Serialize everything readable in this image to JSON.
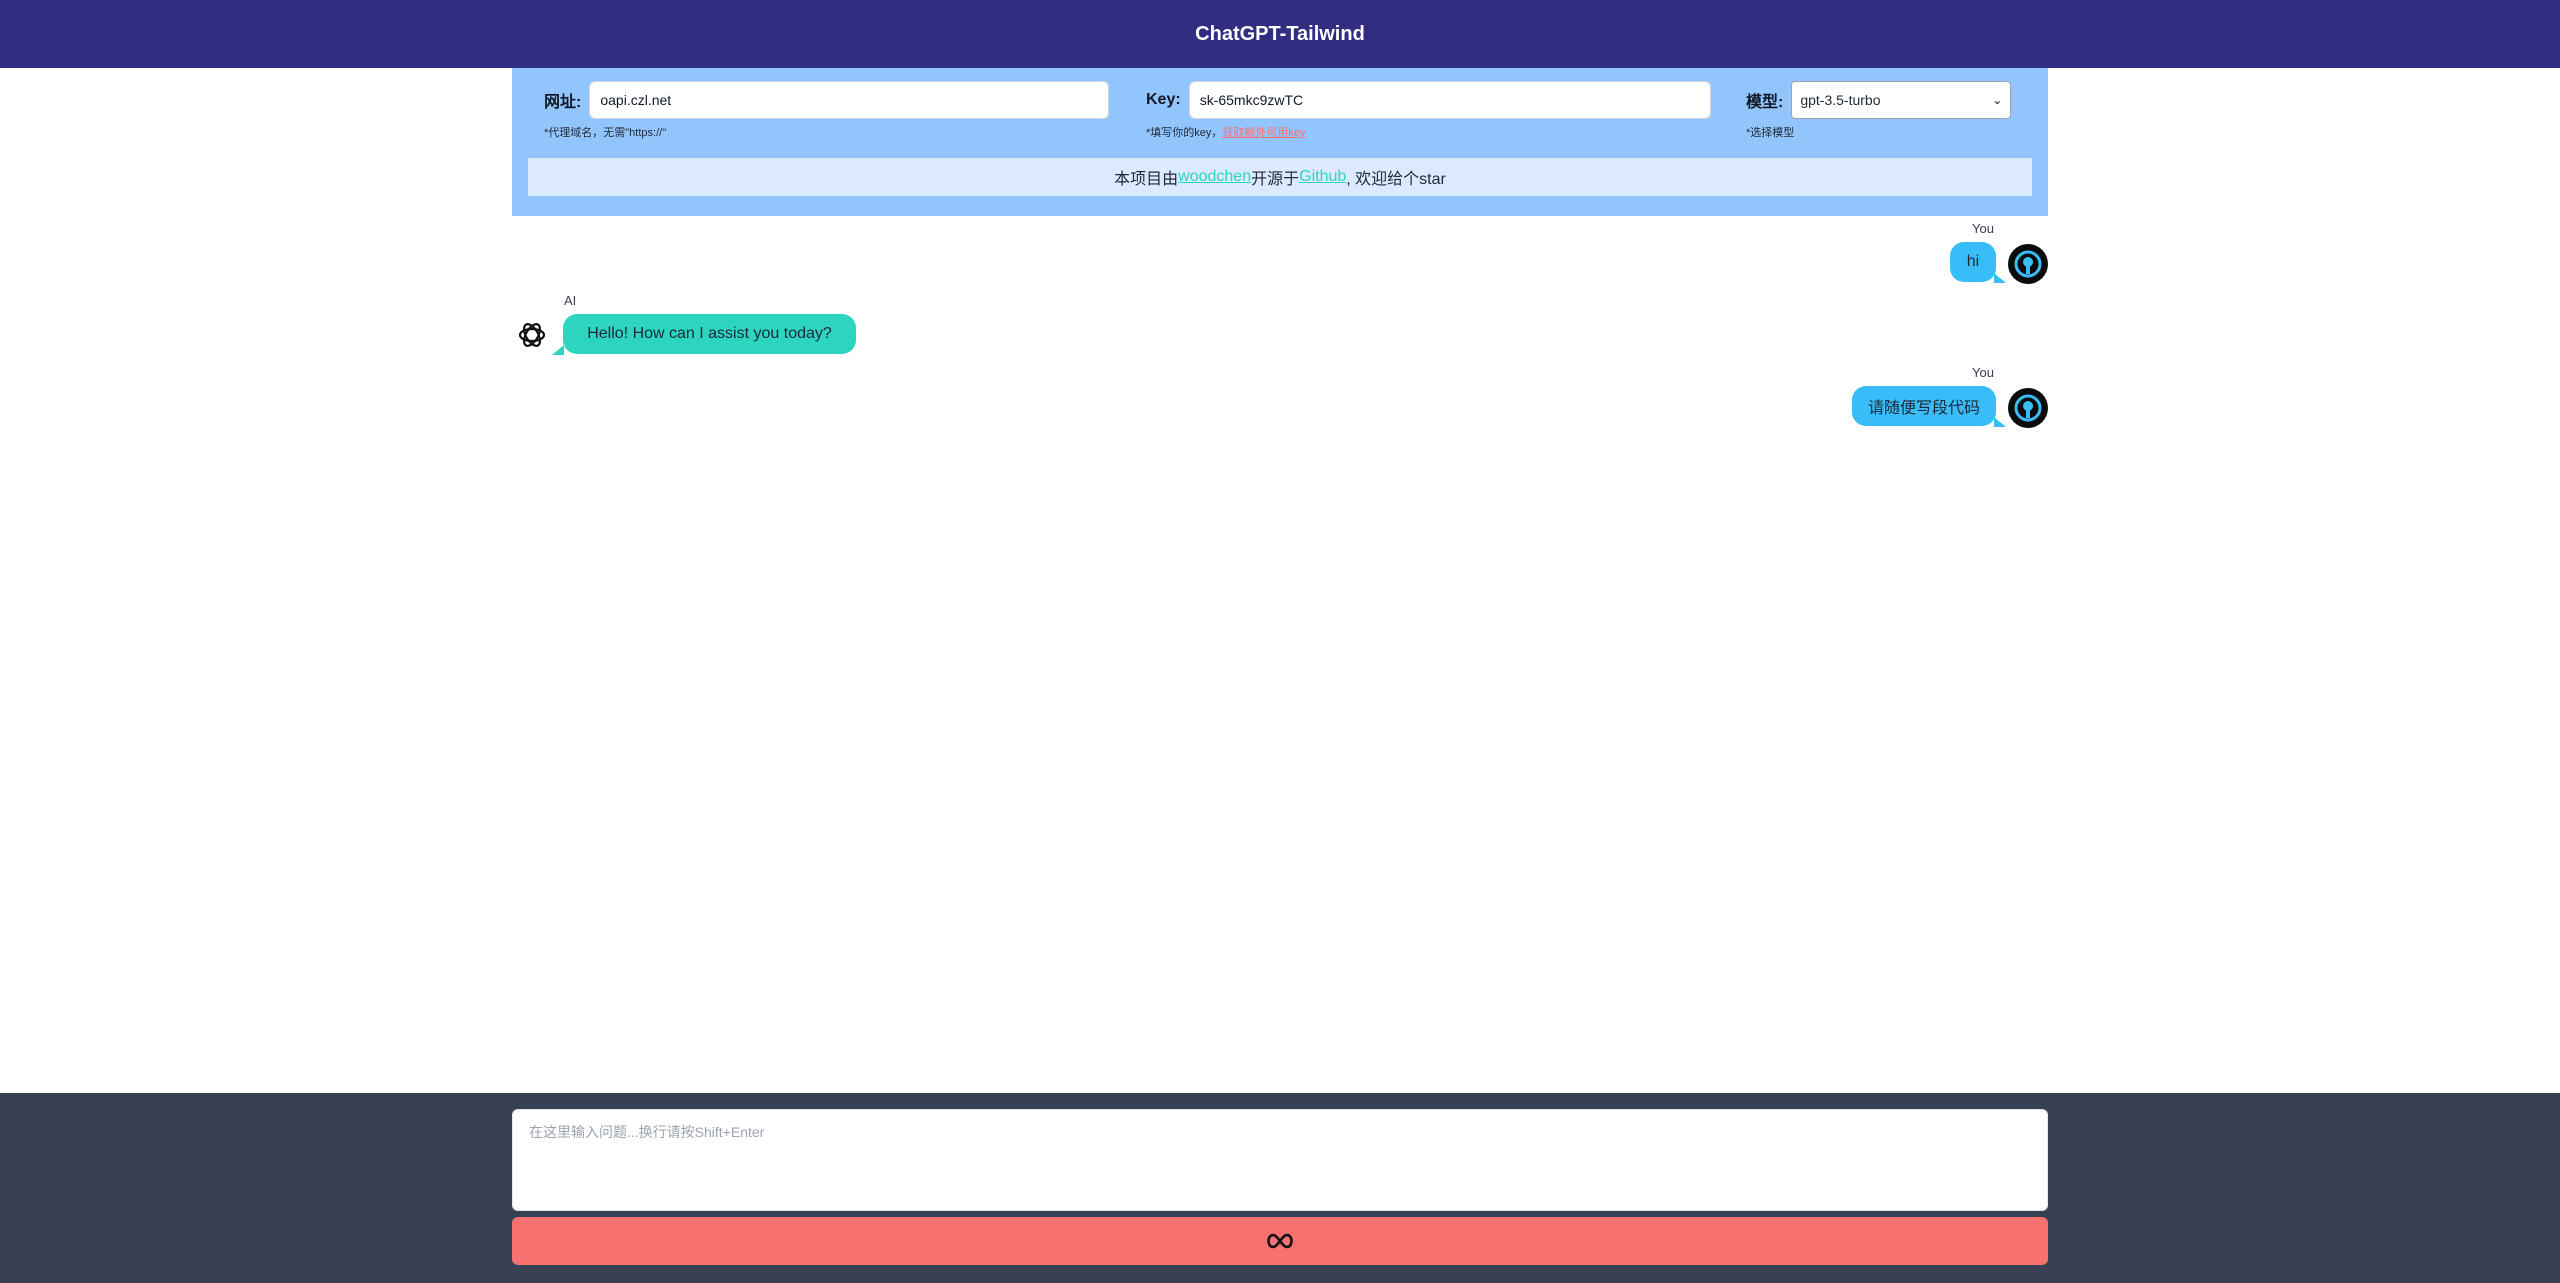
{
  "header": {
    "title": "ChatGPT-Tailwind"
  },
  "config": {
    "url": {
      "label": "网址:",
      "value": "oapi.czl.net",
      "hint": "*代理域名，无需\"https://\""
    },
    "key": {
      "label": "Key:",
      "value": "sk-65mkc9zwTC",
      "hint": "*填写你的key，",
      "hint_link": "获取额外可用key"
    },
    "model": {
      "label": "模型:",
      "selected": "gpt-3.5-turbo",
      "hint": "*选择模型"
    }
  },
  "notice": {
    "prefix": "本项目由",
    "author": "woodchen",
    "middle": "开源于",
    "repo": "Github",
    "suffix": ", 欢迎给个star"
  },
  "messages": [
    {
      "role": "user",
      "name": "You",
      "text": "hi"
    },
    {
      "role": "ai",
      "name": "AI",
      "text": "Hello! How can I assist you today?"
    },
    {
      "role": "user",
      "name": "You",
      "text": "请随便写段代码"
    }
  ],
  "composer": {
    "placeholder": "在这里输入问题...换行请按Shift+Enter",
    "send_icon": "infinity-send-icon"
  },
  "colors": {
    "header": "#312e81",
    "config_bg": "#93c5fd",
    "user_bubble": "#38bdf8",
    "ai_bubble": "#2dd4bf",
    "send_button": "#f87171",
    "footer": "#374151"
  }
}
